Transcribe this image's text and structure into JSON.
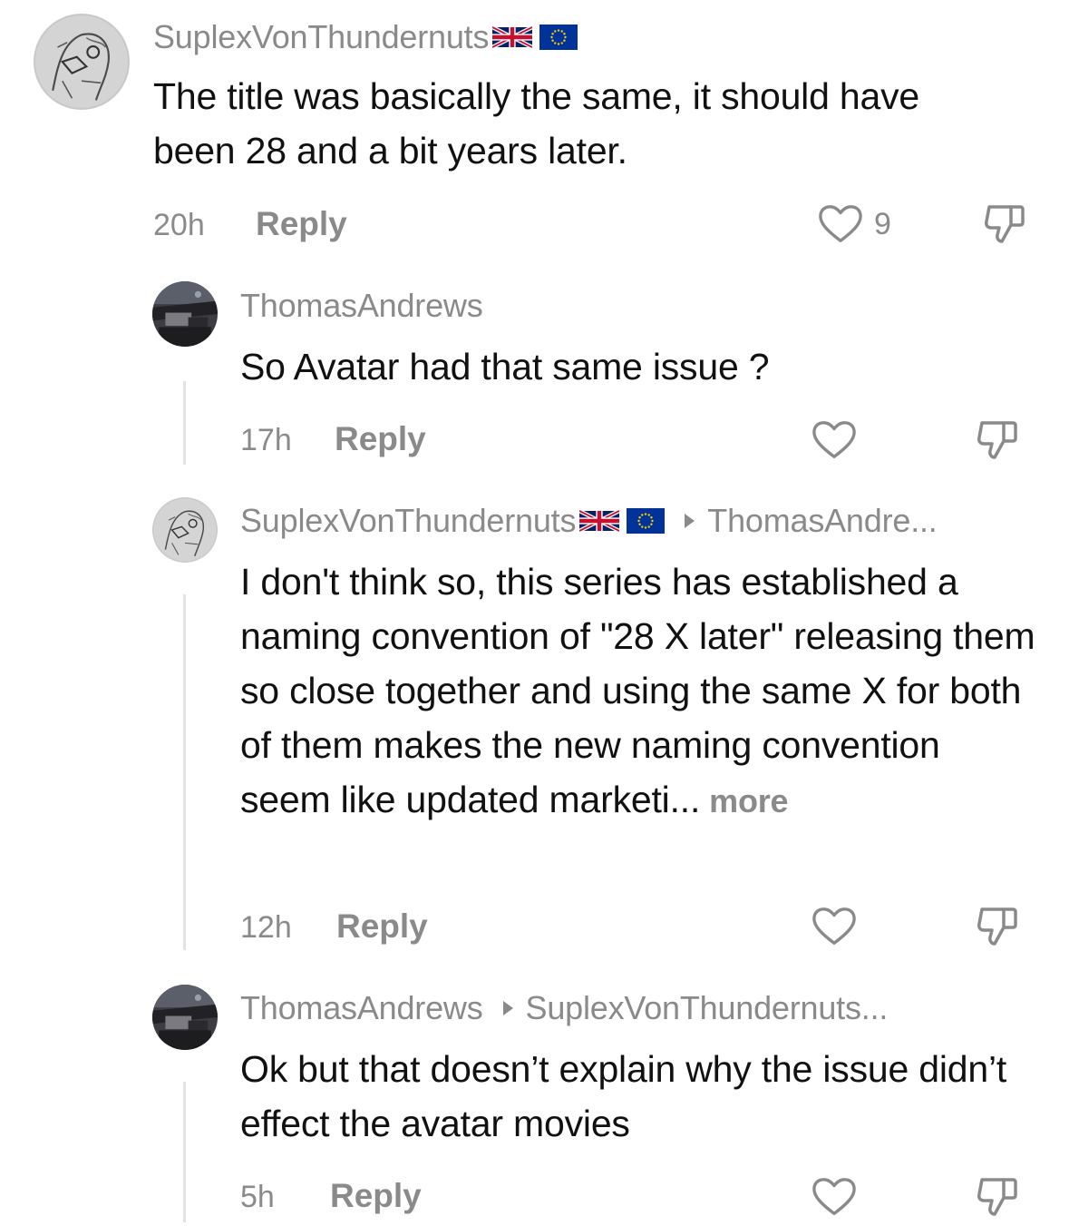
{
  "comments": [
    {
      "username": "SuplexVonThundernuts",
      "text": "The title was basically the same, it should have been 28 and a bit years later.",
      "time": "20h",
      "reply_label": "Reply",
      "like_count": "9"
    },
    {
      "username": "ThomasAndrews",
      "text": "So Avatar had that same issue ?",
      "time": "17h",
      "reply_label": "Reply"
    },
    {
      "username": "SuplexVonThundernuts",
      "reply_to": "ThomasAndre...",
      "text": "I don't think so, this series has established a naming convention of \"28 X later\" releasing them so close together and using the same X for both of them makes the new naming convention seem like updated marketi...",
      "more_label": "more",
      "time": "12h",
      "reply_label": "Reply"
    },
    {
      "username": "ThomasAndrews",
      "reply_to": "SuplexVonThundernuts...",
      "text": "Ok but that doesn’t explain why the issue didn’t effect the avatar movies",
      "time": "5h",
      "reply_label": "Reply"
    }
  ],
  "icons": {
    "like": "heart-outline-icon",
    "dislike": "thumbs-down-outline-icon",
    "flag_uk": "uk-flag-icon",
    "flag_eu": "eu-flag-icon"
  },
  "colors": {
    "muted_text": "#8a8a8a",
    "primary_text": "#111111",
    "thread_line": "#e2e2e2"
  }
}
